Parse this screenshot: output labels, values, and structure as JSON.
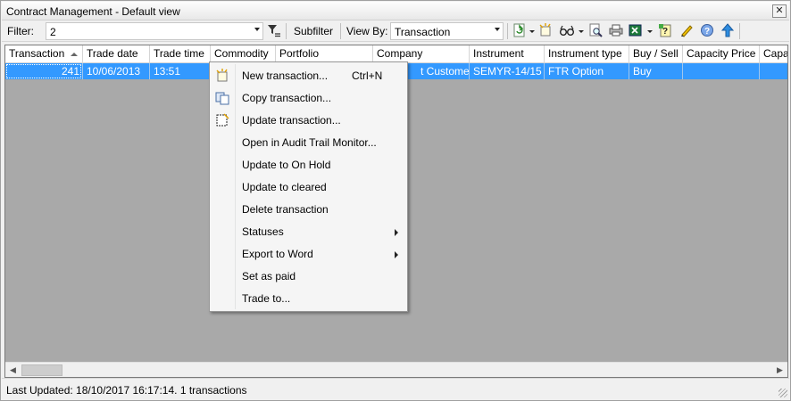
{
  "window": {
    "title": "Contract Management - Default view",
    "close_glyph": "✕"
  },
  "toolbar": {
    "filter_label": "Filter:",
    "filter_value": "2",
    "subfilter_label": "Subfilter",
    "view_by_label": "View By:",
    "view_by_value": "Transaction",
    "icons": [
      "filter-clear-icon",
      "refresh-icon",
      "new-transaction-icon",
      "glasses-icon",
      "print-preview-icon",
      "print-icon",
      "excel-export-icon",
      "report-icon",
      "edit-icon",
      "help-icon",
      "upload-icon"
    ]
  },
  "grid": {
    "columns": [
      "Transaction",
      "Trade date",
      "Trade time",
      "Commodity",
      "Portfolio",
      "Company",
      "Instrument",
      "Instrument type",
      "Buy / Sell",
      "Capacity Price",
      "Capa"
    ],
    "rows": [
      {
        "cells": [
          "241",
          "10/06/2013",
          "13:51",
          "",
          "",
          "t Customer",
          "SEMYR-14/15",
          "FTR Option",
          "Buy",
          "",
          ""
        ]
      }
    ],
    "selected_row_color": "#3399ff"
  },
  "context_menu": {
    "items": [
      {
        "label": "New transaction...",
        "shortcut": "Ctrl+N",
        "icon": "new-transaction-icon"
      },
      {
        "label": "Copy transaction...",
        "icon": "copy-icon"
      },
      {
        "label": "Update transaction...",
        "icon": "update-icon"
      },
      {
        "label": "Open in Audit Trail Monitor..."
      },
      {
        "label": "Update to On Hold"
      },
      {
        "label": "Update to cleared"
      },
      {
        "label": "Delete transaction"
      },
      {
        "label": "Statuses",
        "submenu": true
      },
      {
        "label": "Export to Word",
        "submenu": true
      },
      {
        "label": "Set as paid"
      },
      {
        "label": "Trade to..."
      }
    ]
  },
  "scrollbar": {
    "left_glyph": "◀",
    "right_glyph": "▶"
  },
  "status": {
    "text": "Last Updated: 18/10/2017 16:17:14. 1 transactions"
  }
}
